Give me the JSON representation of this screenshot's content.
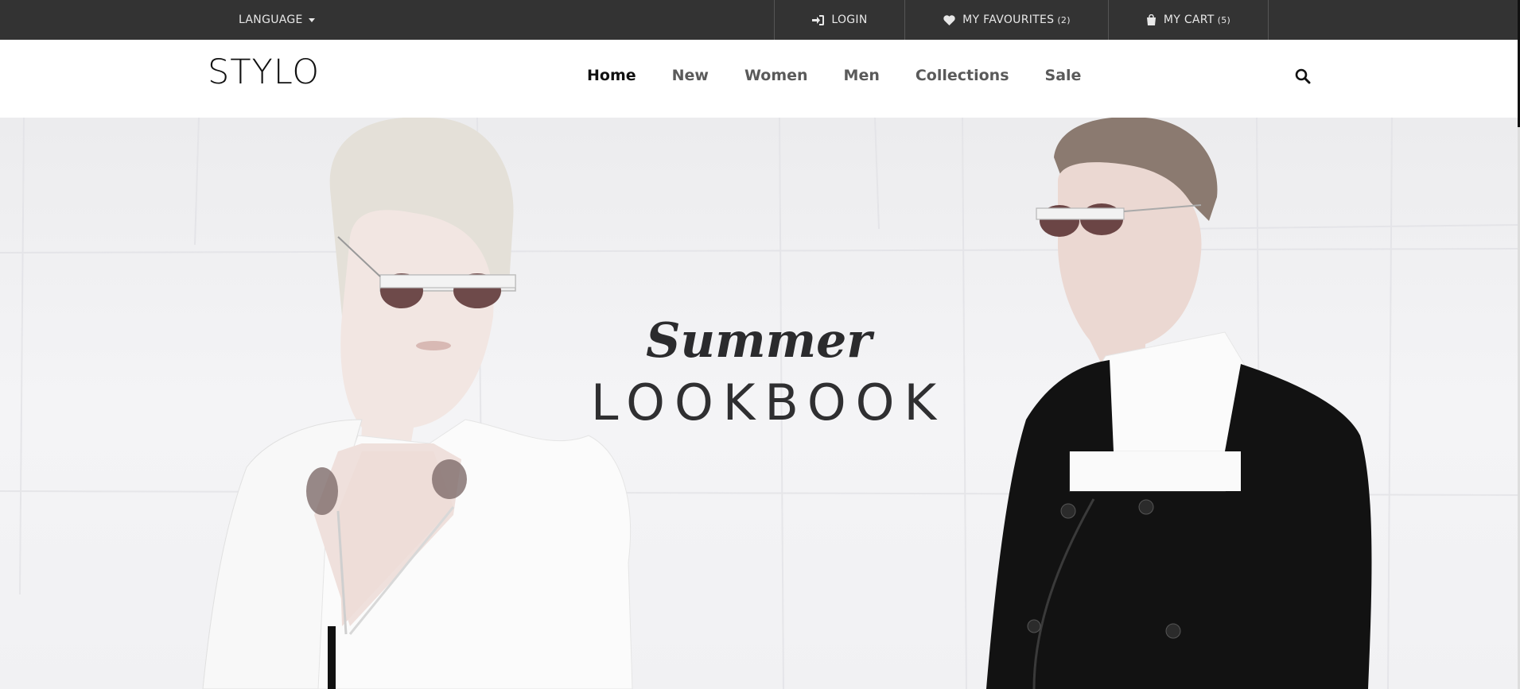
{
  "topbar": {
    "language_label": "LANGUAGE",
    "login_label": "LOGIN",
    "favourites_label": "MY FAVOURITES",
    "favourites_count": "(2)",
    "cart_label": "MY CART",
    "cart_count": "(5)"
  },
  "header": {
    "logo": "STYLO",
    "nav": [
      "Home",
      "New",
      "Women",
      "Men",
      "Collections",
      "Sale"
    ],
    "active_nav": "Home"
  },
  "hero": {
    "subtitle": "Summer",
    "title": "LOOKBOOK"
  },
  "colors": {
    "topbar_bg": "#333333",
    "text_dark": "#111111",
    "nav_text": "#5a5a5a"
  }
}
